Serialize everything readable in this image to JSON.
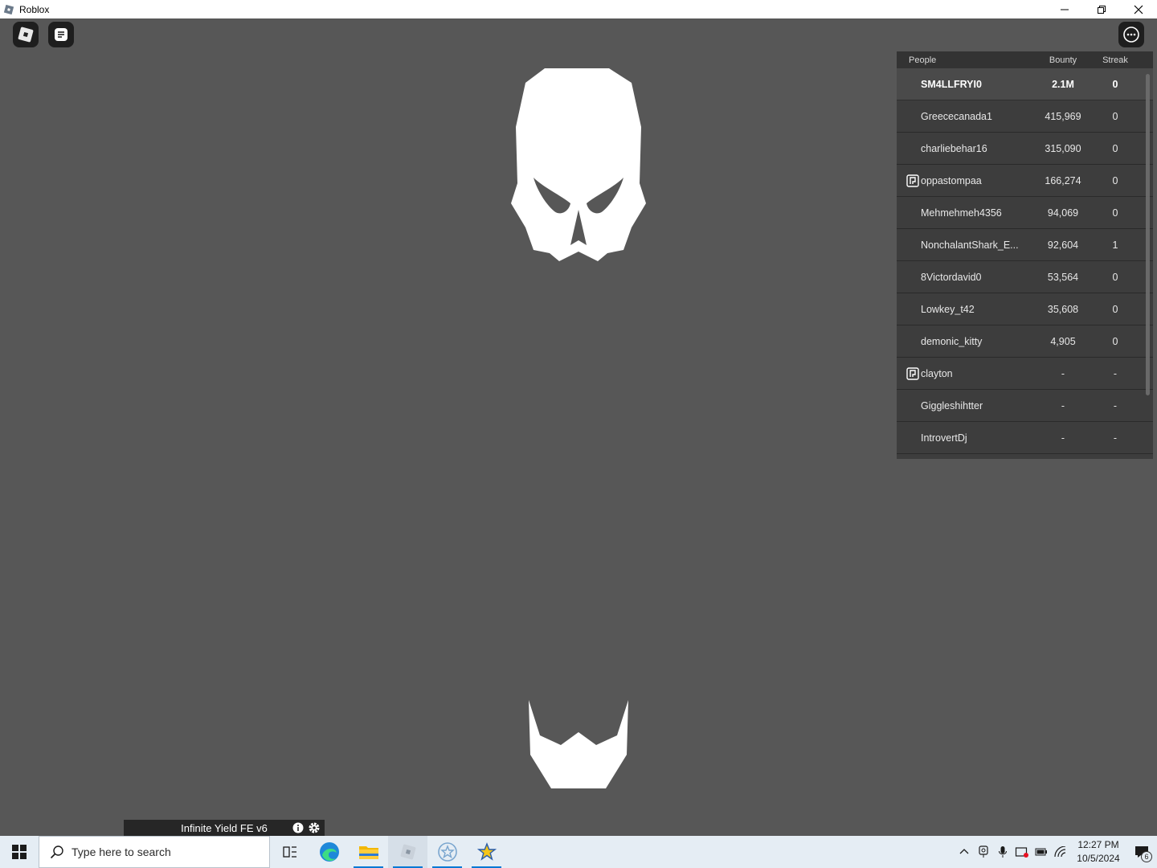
{
  "window": {
    "title": "Roblox"
  },
  "leaderboard": {
    "headers": {
      "people": "People",
      "bounty": "Bounty",
      "streak": "Streak"
    },
    "rows": [
      {
        "name": "SM4LLFRYI0",
        "bounty": "2.1M",
        "streak": "0",
        "badge": false,
        "me": true
      },
      {
        "name": "Greececanada1",
        "bounty": "415,969",
        "streak": "0",
        "badge": false,
        "me": false
      },
      {
        "name": "charliebehar16",
        "bounty": "315,090",
        "streak": "0",
        "badge": false,
        "me": false
      },
      {
        "name": "oppastompaa",
        "bounty": "166,274",
        "streak": "0",
        "badge": true,
        "me": false
      },
      {
        "name": "Mehmehmeh4356",
        "bounty": "94,069",
        "streak": "0",
        "badge": false,
        "me": false
      },
      {
        "name": "NonchalantShark_E...",
        "bounty": "92,604",
        "streak": "1",
        "badge": false,
        "me": false
      },
      {
        "name": "8Victordavid0",
        "bounty": "53,564",
        "streak": "0",
        "badge": false,
        "me": false
      },
      {
        "name": "Lowkey_t42",
        "bounty": "35,608",
        "streak": "0",
        "badge": false,
        "me": false
      },
      {
        "name": "demonic_kitty",
        "bounty": "4,905",
        "streak": "0",
        "badge": false,
        "me": false
      },
      {
        "name": "clayton",
        "bounty": "-",
        "streak": "-",
        "badge": true,
        "me": false
      },
      {
        "name": "Giggleshihtter",
        "bounty": "-",
        "streak": "-",
        "badge": false,
        "me": false
      },
      {
        "name": "IntrovertDj",
        "bounty": "-",
        "streak": "-",
        "badge": false,
        "me": false
      }
    ]
  },
  "infinite_yield": {
    "title": "Infinite Yield FE v6"
  },
  "taskbar": {
    "search_placeholder": "Type here to search",
    "time": "12:27 PM",
    "date": "10/5/2024",
    "notification_count": "6"
  },
  "colors": {
    "game_bg": "#575757",
    "taskbar_bg": "#e5edf4",
    "accent": "#0078d4"
  }
}
